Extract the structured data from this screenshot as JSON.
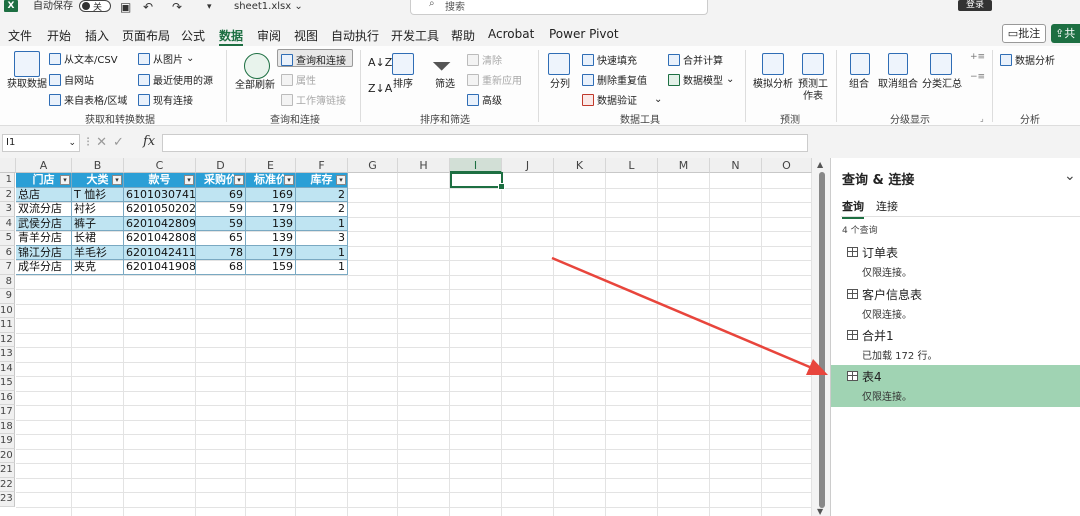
{
  "titlebar": {
    "autosave_label": "自动保存",
    "autosave_state": "关",
    "filename": "sheet1.xlsx",
    "search_placeholder": "搜索",
    "login_label": "登录"
  },
  "menu": {
    "tabs": [
      "文件",
      "开始",
      "插入",
      "页面布局",
      "公式",
      "数据",
      "审阅",
      "视图",
      "自动执行",
      "开发工具",
      "帮助",
      "Acrobat",
      "Power Pivot"
    ],
    "active_tab": "数据",
    "comment_label": "批注",
    "share_label": "共"
  },
  "ribbon": {
    "get_data": {
      "big_label": "获取数据",
      "from_text": "从文本/CSV",
      "from_web": "自网站",
      "from_table": "来自表格/区域",
      "from_picture": "从图片",
      "recent_sources": "最近使用的源",
      "existing_connections": "现有连接",
      "group_label": "获取和转换数据"
    },
    "queries": {
      "refresh_all": "全部刷新",
      "queries_connections": "查询和连接",
      "properties": "属性",
      "edit_links": "工作簿链接",
      "group_label": "查询和连接"
    },
    "sort_filter": {
      "sort": "排序",
      "filter": "筛选",
      "clear": "清除",
      "reapply": "重新应用",
      "advanced": "高级",
      "group_label": "排序和筛选"
    },
    "data_tools": {
      "text_to_columns": "分列",
      "flash_fill": "快速填充",
      "remove_duplicates": "删除重复值",
      "data_validation": "数据验证",
      "consolidate": "合并计算",
      "data_model": "数据模型",
      "group_label": "数据工具"
    },
    "forecast": {
      "what_if": "模拟分析",
      "forecast_sheet": "预测工作表",
      "group_label": "预测"
    },
    "outline": {
      "group": "组合",
      "ungroup": "取消组合",
      "subtotal": "分类汇总",
      "group_label": "分级显示"
    },
    "analysis": {
      "data_analysis": "数据分析",
      "group_label": "分析"
    }
  },
  "formula_bar": {
    "name_box": "I1",
    "fx": "fx",
    "formula": ""
  },
  "sheet": {
    "columns": [
      "A",
      "B",
      "C",
      "D",
      "E",
      "F",
      "G",
      "H",
      "I",
      "J",
      "K",
      "L",
      "M",
      "N",
      "O"
    ],
    "selected_column": "I",
    "rows": [
      "1",
      "2",
      "3",
      "4",
      "5",
      "6",
      "7",
      "8",
      "9",
      "10",
      "11",
      "12",
      "13",
      "14",
      "15",
      "16",
      "17",
      "18",
      "19",
      "20",
      "21",
      "22",
      "23"
    ],
    "table_headers": [
      "门店",
      "大类",
      "款号",
      "采购价",
      "标准价",
      "库存"
    ],
    "table_rows": [
      [
        "总店",
        "T 恤衫",
        "6101030741",
        "69",
        "169",
        "2"
      ],
      [
        "双流分店",
        "衬衫",
        "6201050202",
        "59",
        "179",
        "2"
      ],
      [
        "武侯分店",
        "裤子",
        "6201042809",
        "59",
        "139",
        "1"
      ],
      [
        "青羊分店",
        "长裙",
        "6201042808",
        "65",
        "139",
        "3"
      ],
      [
        "锦江分店",
        "羊毛衫",
        "6201042411",
        "78",
        "179",
        "1"
      ],
      [
        "成华分店",
        "夹克",
        "6201041908",
        "68",
        "159",
        "1"
      ]
    ]
  },
  "query_pane": {
    "title": "查询 & 连接",
    "tabs": [
      "查询",
      "连接"
    ],
    "count_label": "4 个查询",
    "items": [
      {
        "name": "订单表",
        "status": "仅限连接。"
      },
      {
        "name": "客户信息表",
        "status": "仅限连接。"
      },
      {
        "name": "合并1",
        "status": "已加载 172 行。"
      },
      {
        "name": "表4",
        "status": "仅限连接。"
      }
    ],
    "selected_item": "表4"
  },
  "colors": {
    "excel_green": "#1d6f42",
    "table_header": "#2b9fd6",
    "table_band": "#bfe4f2",
    "selected_query": "#a0d3b3",
    "annotation_arrow": "#e8453c"
  }
}
